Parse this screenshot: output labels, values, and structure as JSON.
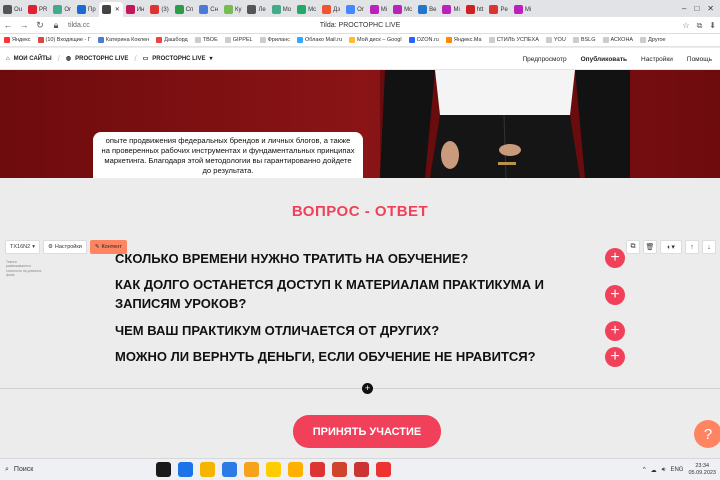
{
  "browser": {
    "tabs": [
      {
        "label": "Ou",
        "color": "#555"
      },
      {
        "label": "PR",
        "color": "#d23"
      },
      {
        "label": "Or",
        "color": "#4a8"
      },
      {
        "label": "Пр",
        "color": "#1a6ad6"
      },
      {
        "label": "",
        "color": "#444",
        "active": true
      },
      {
        "label": "Ин",
        "color": "#c2185b"
      },
      {
        "label": "(3)",
        "color": "#d33"
      },
      {
        "label": "Сп",
        "color": "#2a9d4b"
      },
      {
        "label": "Сн",
        "color": "#4a7bd6"
      },
      {
        "label": "Ку",
        "color": "#7b5"
      },
      {
        "label": "Ле",
        "color": "#555"
      },
      {
        "label": "Mo",
        "color": "#4a8"
      },
      {
        "label": "Mc",
        "color": "#2a6"
      },
      {
        "label": "Дз",
        "color": "#e53"
      },
      {
        "label": "Or",
        "color": "#48f"
      },
      {
        "label": "Mi",
        "color": "#b2b"
      },
      {
        "label": "Mc",
        "color": "#b2b"
      },
      {
        "label": "Be",
        "color": "#27c"
      },
      {
        "label": "Mi",
        "color": "#b2b"
      },
      {
        "label": "htt",
        "color": "#c22"
      },
      {
        "label": "Pe",
        "color": "#d33"
      },
      {
        "label": "Mi",
        "color": "#b2b"
      }
    ],
    "url": "tilda.cc",
    "page_title": "Tilda: PROCTOPHC LIVE",
    "bookmarks": [
      {
        "label": "Яндекс",
        "color": "#f33"
      },
      {
        "label": "(10) Входящие - Г",
        "color": "#d44"
      },
      {
        "label": "Катерина Коклен",
        "color": "#4a7bd6"
      },
      {
        "label": "Дашборд",
        "color": "#e44"
      },
      {
        "label": "TBOE",
        "color": "#ccc"
      },
      {
        "label": "GIPPEL",
        "color": "#ccc"
      },
      {
        "label": "Фриланс",
        "color": "#ccc"
      },
      {
        "label": "Облако Mail.ru",
        "color": "#3af"
      },
      {
        "label": "Мой диск – Googl",
        "color": "#fb3"
      },
      {
        "label": "OZON.ru",
        "color": "#26f"
      },
      {
        "label": "Яндекс.Ма",
        "color": "#f80"
      },
      {
        "label": "СТИЛЬ УСПЕХА",
        "color": "#ccc"
      },
      {
        "label": "YOU",
        "color": "#ccc"
      },
      {
        "label": "BSLG",
        "color": "#ccc"
      },
      {
        "label": "АСКОНА",
        "color": "#ccc"
      },
      {
        "label": "Другое",
        "color": "#ccc"
      }
    ]
  },
  "tilda": {
    "my_sites": "МОИ САЙТЫ",
    "project": "PROCTOPHC LIVE",
    "page": "PROCTOPHC LIVE",
    "preview": "Предпросмотр",
    "publish": "Опубликовать",
    "settings": "Настройки",
    "help": "Помощь"
  },
  "hero": {
    "card_text": "опыте продвижения федеральных брендов и личных блогов, а также на проверенных рабочих инструментах и фундаментальных принципах маркетинга. Благодаря этой методологии вы гарантированно дойдете до результата."
  },
  "editor": {
    "block_id": "TX16N2",
    "settings_label": "Настройки",
    "content_label": "Контент",
    "block_description": "Тексты развешиваются соосность на длинных фона"
  },
  "faq": {
    "title": "ВОПРОС - ОТВЕТ",
    "questions": [
      "СКОЛЬКО ВРЕМЕНИ НУЖНО ТРАТИТЬ НА ОБУЧЕНИЕ?",
      "КАК ДОЛГО ОСТАНЕТСЯ ДОСТУП К МАТЕРИАЛАМ ПРАКТИКУМА И ЗАПИСЯМ УРОКОВ?",
      "ЧЕМ ВАШ ПРАКТИКУМ ОТЛИЧАЕТСЯ ОТ ДРУГИХ?",
      "МОЖНО ЛИ ВЕРНУТЬ ДЕНЬГИ, ЕСЛИ ОБУЧЕНИЕ НЕ НРАВИТСЯ?"
    ],
    "cta": "ПРИНЯТЬ УЧАСТИЕ",
    "help_glyph": "?"
  },
  "taskbar": {
    "search_label": "Поиск",
    "lang": "ENG",
    "time": "23:34",
    "date": "05.09.2023",
    "apps": [
      "#1a1a1a",
      "#1a73e8",
      "#f4b400",
      "#2c7be5",
      "#f7a21b",
      "#ffcc00",
      "#ffb000",
      "#d33",
      "#d0442b",
      "#c33",
      "#e33"
    ]
  },
  "colors": {
    "accent": "#f0405a",
    "hero": "#7a0e10",
    "editor_content": "#ff8562"
  }
}
